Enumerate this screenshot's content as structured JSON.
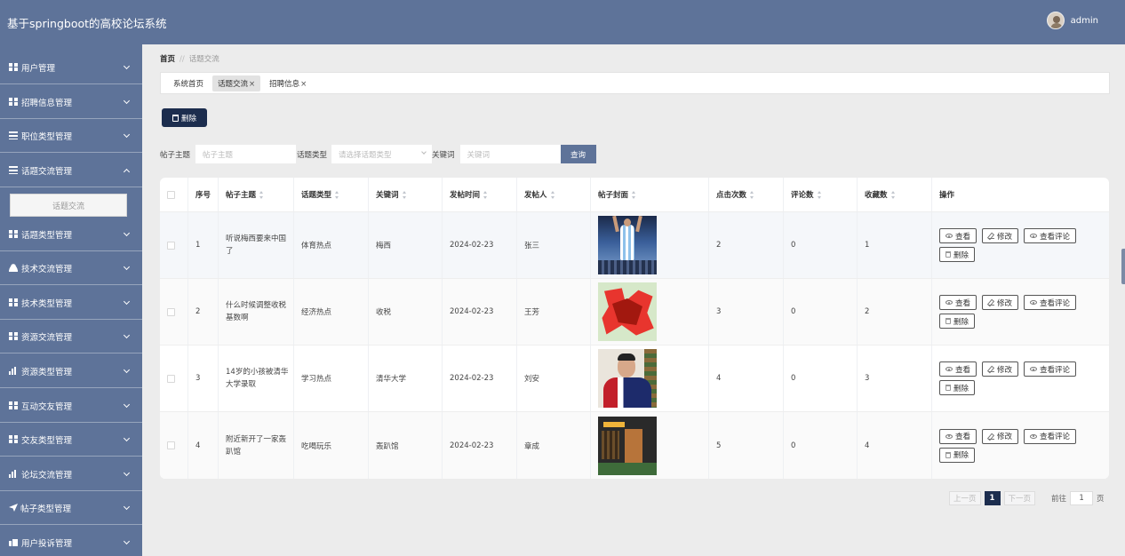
{
  "header": {
    "title": "基于springboot的高校论坛系统",
    "username": "admin"
  },
  "sidebar": {
    "items": [
      {
        "label": "用户管理",
        "icon": "grid-icon",
        "expanded": false
      },
      {
        "label": "招聘信息管理",
        "icon": "table-icon",
        "expanded": false
      },
      {
        "label": "职位类型管理",
        "icon": "sliders-icon",
        "expanded": false
      },
      {
        "label": "话题交流管理",
        "icon": "list-icon",
        "expanded": true
      },
      {
        "label": "话题类型管理",
        "icon": "grid-icon",
        "expanded": false
      },
      {
        "label": "技术交流管理",
        "icon": "user-icon",
        "expanded": false
      },
      {
        "label": "技术类型管理",
        "icon": "grid-icon",
        "expanded": false
      },
      {
        "label": "资源交流管理",
        "icon": "grid-icon",
        "expanded": false
      },
      {
        "label": "资源类型管理",
        "icon": "chart-icon",
        "expanded": false
      },
      {
        "label": "互动交友管理",
        "icon": "grid-icon",
        "expanded": false
      },
      {
        "label": "交友类型管理",
        "icon": "grid-icon",
        "expanded": false
      },
      {
        "label": "论坛交流管理",
        "icon": "bar-chart-icon",
        "expanded": false
      },
      {
        "label": "帖子类型管理",
        "icon": "send-icon",
        "expanded": false
      },
      {
        "label": "用户投诉管理",
        "icon": "hand-icon",
        "expanded": false
      }
    ],
    "subitem": "话题交流"
  },
  "breadcrumb": {
    "home": "首页",
    "separator": "//",
    "current": "话题交流"
  },
  "tabs": [
    {
      "label": "系统首页",
      "closable": false
    },
    {
      "label": "话题交流",
      "closable": true
    },
    {
      "label": "招聘信息",
      "closable": true
    }
  ],
  "toolbar": {
    "delete_label": "删除"
  },
  "search": {
    "title_label": "帖子主题",
    "title_placeholder": "帖子主题",
    "type_label": "话题类型",
    "type_placeholder": "请选择话题类型",
    "keyword_label": "关键词",
    "keyword_placeholder": "关键词",
    "query_label": "查询"
  },
  "table": {
    "columns": [
      "序号",
      "帖子主题",
      "话题类型",
      "关键词",
      "发帖时间",
      "发帖人",
      "帖子封面",
      "点击次数",
      "评论数",
      "收藏数",
      "操作"
    ],
    "rows": [
      {
        "index": "1",
        "title": "听说梅西要来中国了",
        "type": "体育热点",
        "keyword": "梅西",
        "time": "2024-02-23",
        "author": "张三",
        "cover": "soccer-player-cover",
        "clicks": "2",
        "comments": "0",
        "favorites": "1"
      },
      {
        "index": "2",
        "title": "什么时候调整收税基数啊",
        "type": "经济热点",
        "keyword": "收税",
        "time": "2024-02-23",
        "author": "王芳",
        "cover": "red-tax-character-cover",
        "clicks": "3",
        "comments": "0",
        "favorites": "2"
      },
      {
        "index": "3",
        "title": "14岁的小孩被清华大学录取",
        "type": "学习热点",
        "keyword": "清华大学",
        "time": "2024-02-23",
        "author": "刘安",
        "cover": "student-portrait-cover",
        "clicks": "4",
        "comments": "0",
        "favorites": "3"
      },
      {
        "index": "4",
        "title": "附近新开了一家轰趴馆",
        "type": "吃喝玩乐",
        "keyword": "轰趴馆",
        "time": "2024-02-23",
        "author": "章成",
        "cover": "party-venue-cover",
        "clicks": "5",
        "comments": "0",
        "favorites": "4"
      }
    ],
    "actions": {
      "view": "查看",
      "edit": "修改",
      "view_comments": "查看评论",
      "delete": "删除"
    }
  },
  "pagination": {
    "prev": "上一页",
    "current": "1",
    "next": "下一页",
    "goto_label": "前往",
    "goto_value": "1",
    "page_unit": "页"
  },
  "colors": {
    "sidebar_bg": "#5e7399",
    "primary_dark": "#1c2d4e",
    "page_bg": "#ececec"
  }
}
